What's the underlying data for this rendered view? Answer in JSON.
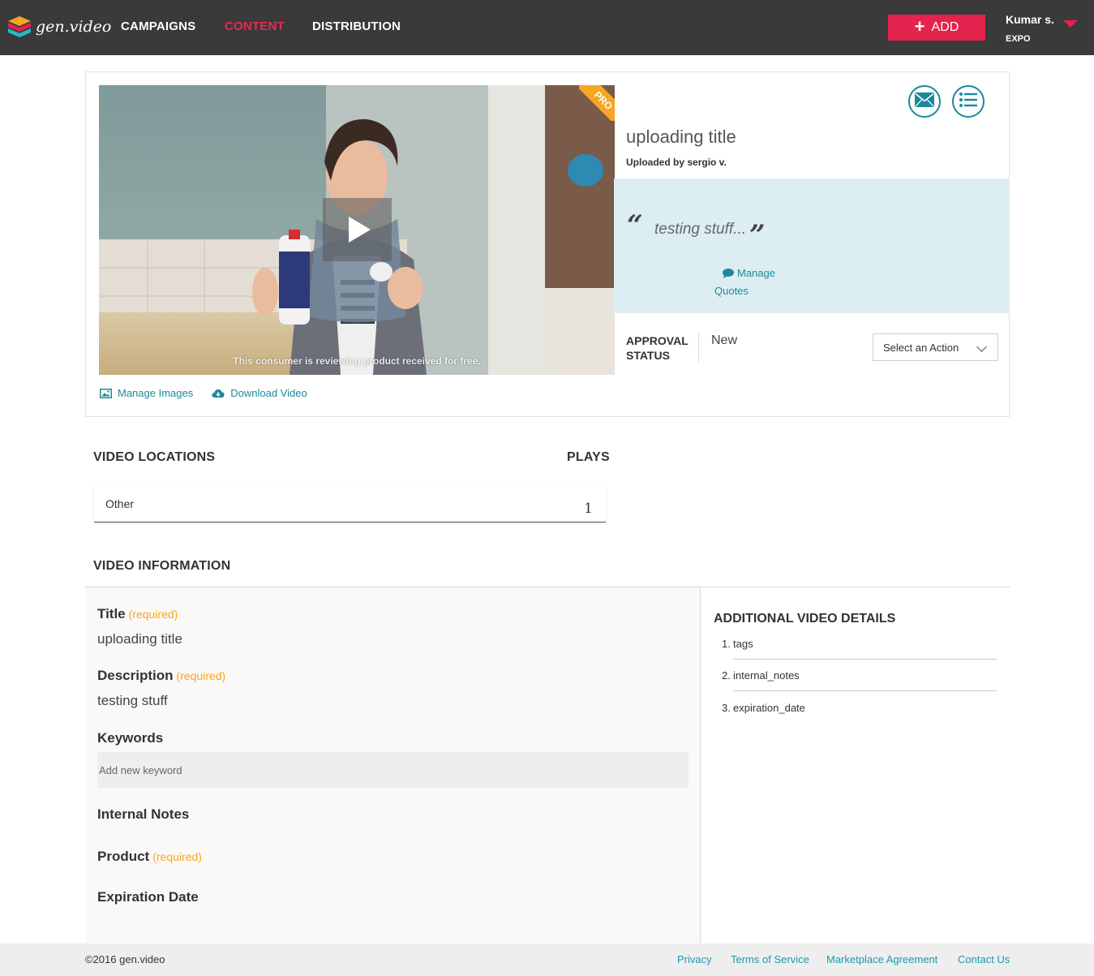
{
  "header": {
    "logo_text": "gen.video",
    "nav": [
      "CAMPAIGNS",
      "CONTENT",
      "DISTRIBUTION"
    ],
    "active_nav": "CONTENT",
    "add_label": "ADD",
    "user_name": "Kumar s.",
    "user_org": "EXPO"
  },
  "media": {
    "disclaimer": "This consumer is reviewing product received for free.",
    "pro_badge": "PRO",
    "manage_images": "Manage Images",
    "download_video": "Download Video",
    "title": "uploading title",
    "uploaded_by": "Uploaded by sergio v.",
    "quote": "testing stuff...",
    "manage_quotes": "Manage Quotes",
    "approval_label": "APPROVAL STATUS",
    "approval_value": "New",
    "action_select": "Select an Action"
  },
  "locations": {
    "heading": "VIDEO LOCATIONS",
    "plays_heading": "PLAYS",
    "rows": [
      {
        "name": "Other",
        "plays": "1"
      }
    ]
  },
  "info": {
    "heading": "VIDEO INFORMATION",
    "required": "(required)",
    "title_label": "Title",
    "title_value": "uploading title",
    "description_label": "Description",
    "description_value": "testing stuff",
    "keywords_label": "Keywords",
    "keywords_placeholder": "Add new keyword",
    "internal_notes_label": "Internal Notes",
    "product_label": "Product",
    "expiration_label": "Expiration Date"
  },
  "details": {
    "heading": "ADDITIONAL VIDEO DETAILS",
    "items": [
      "tags",
      "internal_notes",
      "expiration_date"
    ]
  },
  "footer": {
    "copyright": "©2016 gen.video",
    "links": [
      "Privacy",
      "Terms of Service",
      "Marketplace Agreement",
      "Contact Us"
    ]
  },
  "colors": {
    "topbar": "#3a3a3a",
    "accent_red": "#e4234e",
    "teal": "#1a8a9a",
    "required_orange": "#f5a623",
    "quote_panel": "#ddeef2"
  },
  "icons": [
    "logo-mark-icon",
    "plus-icon",
    "caret-down-icon",
    "play-icon",
    "image-icon",
    "cloud-download-icon",
    "envelope-icon",
    "list-icon",
    "comment-icon",
    "chevron-down-icon"
  ]
}
